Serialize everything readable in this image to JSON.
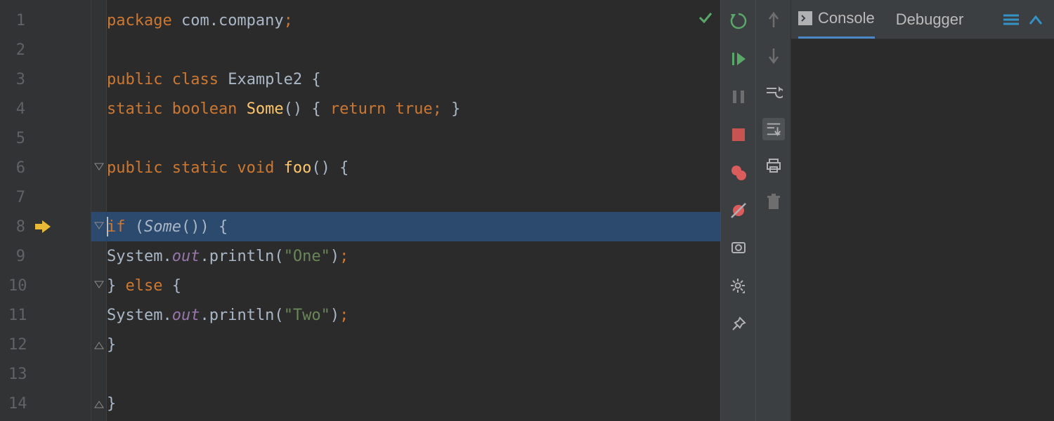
{
  "editor": {
    "lines": [
      "1",
      "2",
      "3",
      "4",
      "5",
      "6",
      "7",
      "8",
      "9",
      "10",
      "11",
      "12",
      "13",
      "14"
    ],
    "execution_line": 8,
    "fold_lines": [
      6,
      8,
      10,
      12,
      14
    ],
    "code": {
      "l1": {
        "t1": "package",
        "t2": " com.company",
        "t3": ";"
      },
      "l3": {
        "t1": "public class",
        "t2": " Example2 {"
      },
      "l4": {
        "t1": "static boolean ",
        "t2": "Some",
        "t3": "() { ",
        "t4": "return true",
        "t5": "; ",
        "t6": "}"
      },
      "l6": {
        "t1": "public static void ",
        "t2": "foo",
        "t3": "() {"
      },
      "l8": {
        "t1": "if ",
        "t2": "(",
        "t3": "Some",
        "t4": "()) {"
      },
      "l9": {
        "t1": "System.",
        "t2": "out",
        "t3": ".println(",
        "t4": "\"One\"",
        "t5": ")",
        "t6": ";"
      },
      "l10": {
        "t1": "} ",
        "t2": "else",
        "t3": " {"
      },
      "l11": {
        "t1": "System.",
        "t2": "out",
        "t3": ".println(",
        "t4": "\"Two\"",
        "t5": ")",
        "t6": ";"
      },
      "l12": {
        "t1": "}"
      },
      "l14": {
        "t1": "}"
      }
    }
  },
  "debug_tabs": {
    "console": "Console",
    "debugger": "Debugger"
  },
  "colors": {
    "green": "#59a869",
    "red": "#c75450",
    "orange": "#e8ba36",
    "grey": "#afb1b3",
    "blue": "#3592c4",
    "breakpoint_red": "#db5c5c"
  }
}
